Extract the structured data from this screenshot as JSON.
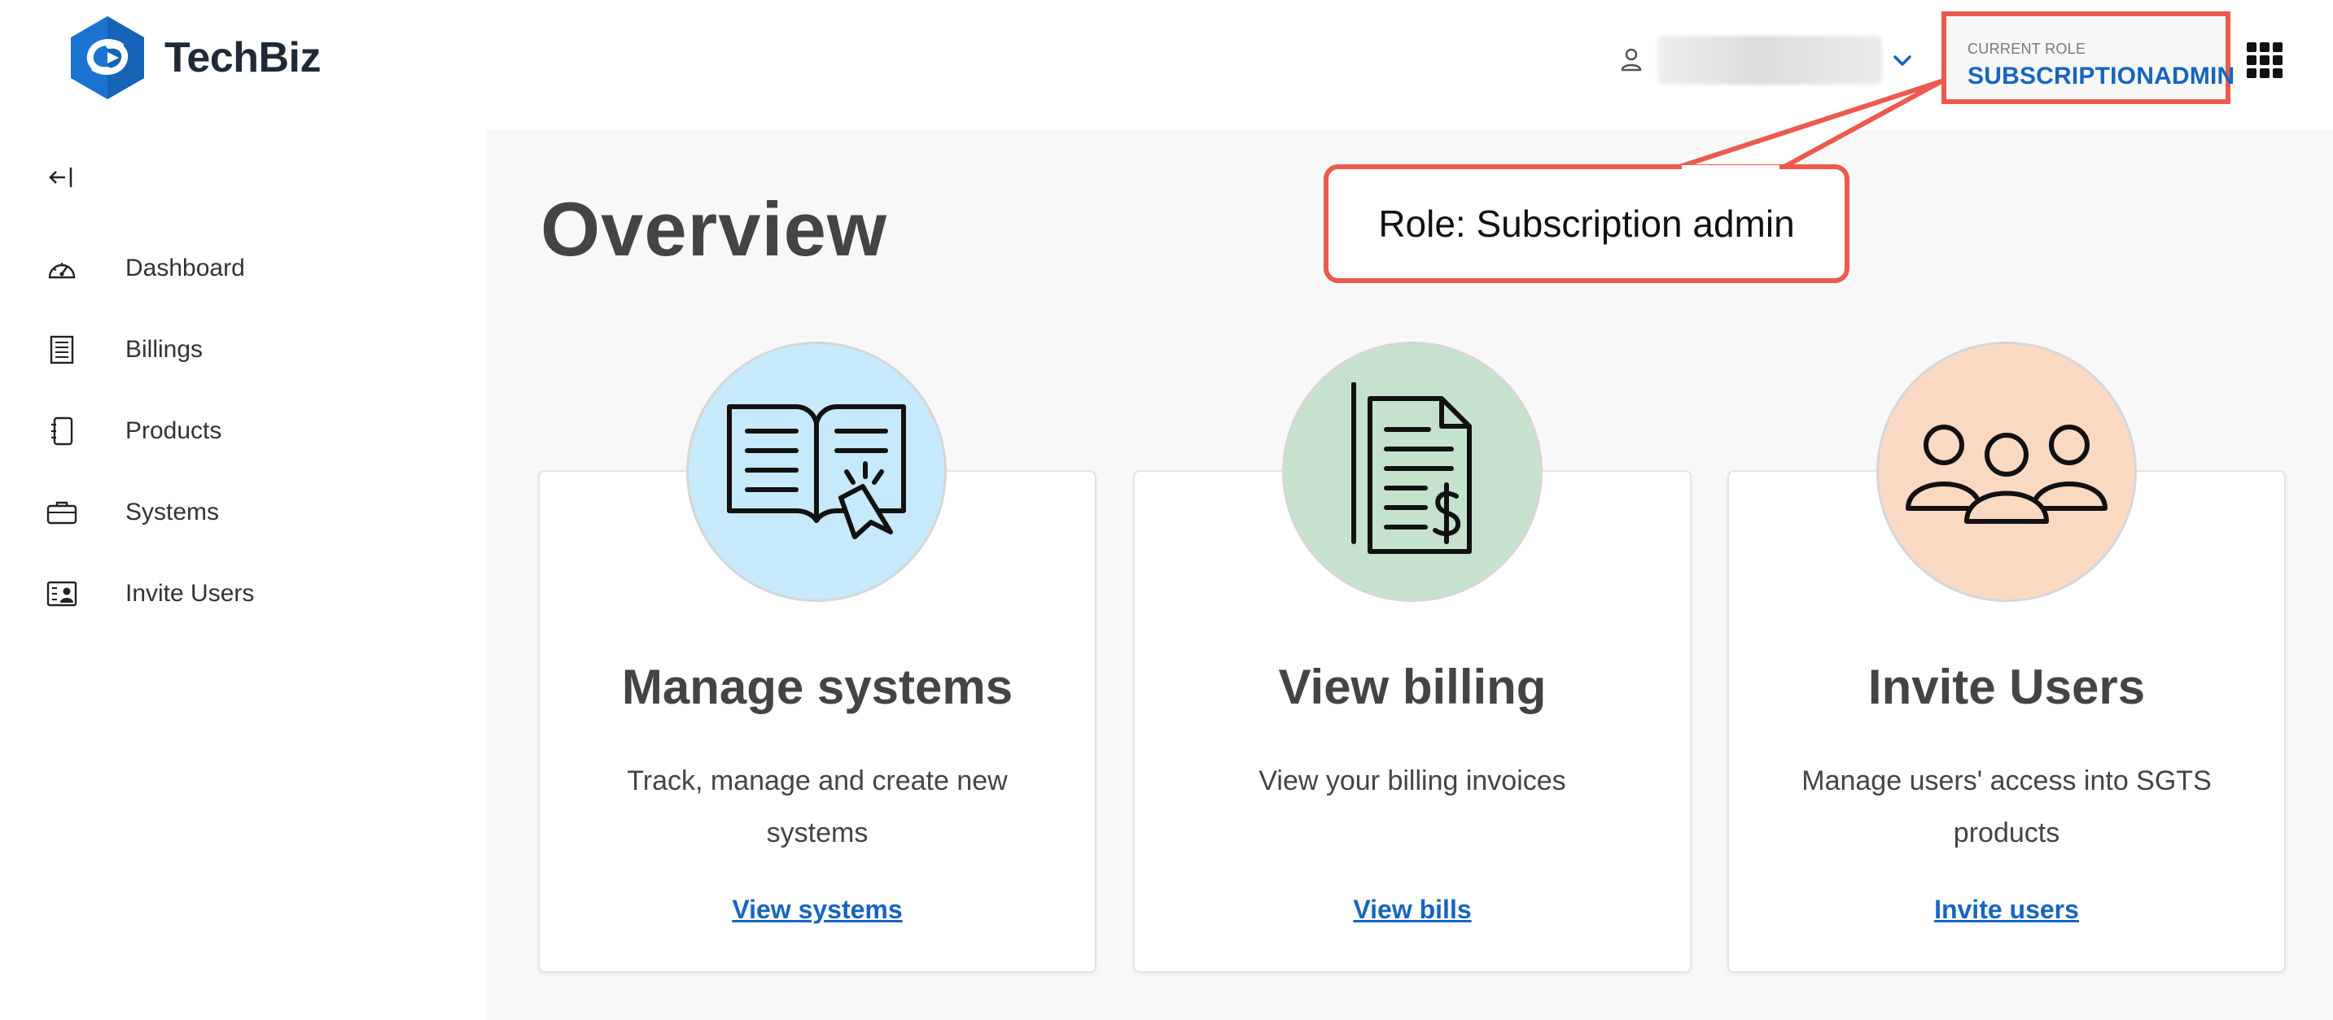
{
  "app": {
    "name": "TechBiz"
  },
  "header": {
    "user_name": "",
    "role_label": "CURRENT ROLE",
    "role_value": "SUBSCRIPTIONADMIN"
  },
  "sidebar": {
    "items": [
      {
        "label": "Dashboard",
        "icon": "dashboard-icon"
      },
      {
        "label": "Billings",
        "icon": "billing-icon"
      },
      {
        "label": "Products",
        "icon": "products-icon"
      },
      {
        "label": "Systems",
        "icon": "systems-icon"
      },
      {
        "label": "Invite Users",
        "icon": "invite-users-icon"
      }
    ]
  },
  "main": {
    "title": "Overview",
    "callout": "Role: Subscription admin",
    "cards": [
      {
        "title": "Manage systems",
        "description": "Track, manage and create new systems",
        "link": "View systems",
        "icon": "book-icon",
        "color": "#c6e9fb"
      },
      {
        "title": "View billing",
        "description": "View your billing invoices",
        "link": "View bills",
        "icon": "invoice-icon",
        "color": "#c5e3cc"
      },
      {
        "title": "Invite Users",
        "description": "Manage users' access into SGTS products",
        "link": "Invite users",
        "icon": "users-icon",
        "color": "#fad9c3"
      }
    ]
  },
  "colors": {
    "accent": "#1565c0",
    "annotation": "#ec5a4e",
    "brand": "#1a73d0"
  }
}
